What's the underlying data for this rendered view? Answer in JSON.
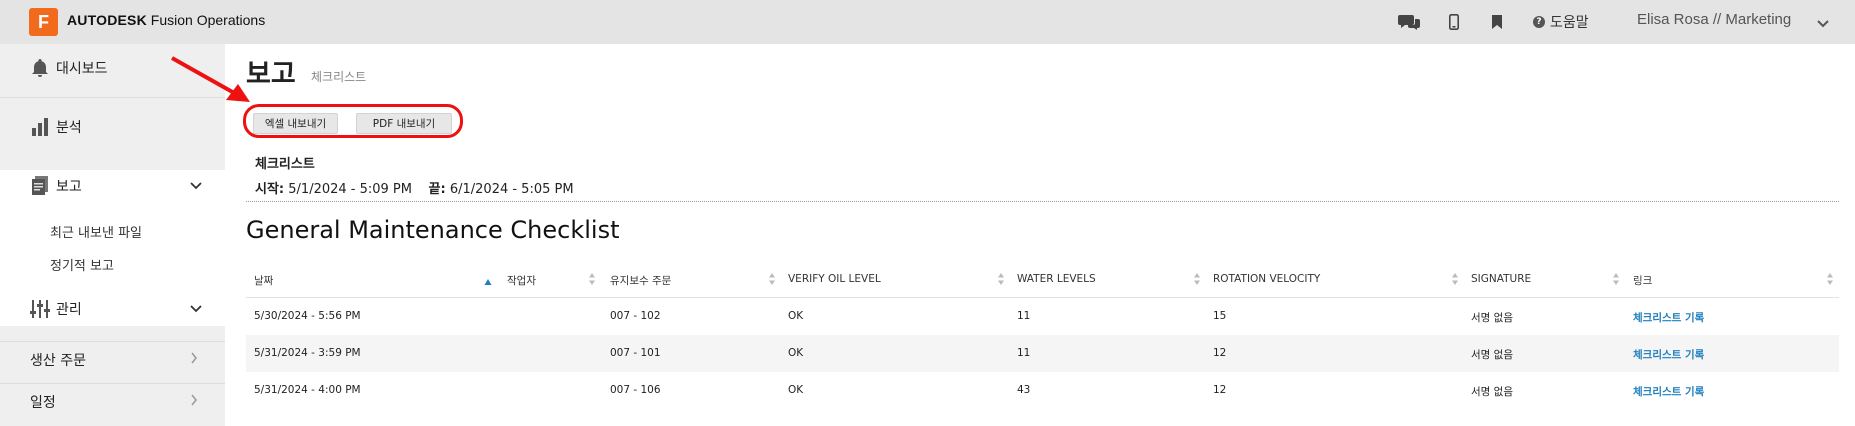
{
  "header": {
    "logo_letter": "F",
    "brand_bold": "AUTODESK",
    "brand_rest": "Fusion Operations",
    "help_label": "도움말",
    "user_label": "Elisa Rosa // Marketing",
    "accent_color": "#f26b1c"
  },
  "sidebar": {
    "items": [
      {
        "label": "대시보드",
        "icon": "bell-icon"
      },
      {
        "label": "분석",
        "icon": "bar-chart-icon"
      },
      {
        "label": "보고",
        "icon": "report-icon"
      },
      {
        "label": "관리",
        "icon": "sliders-icon"
      },
      {
        "label": "생산 주문"
      },
      {
        "label": "일정"
      }
    ],
    "sub_items": [
      "최근 내보낸 파일",
      "정기적 보고"
    ]
  },
  "page": {
    "title": "보고",
    "subtitle": "체크리스트",
    "export_excel": "엑셀 내보내기",
    "export_pdf": "PDF 내보내기",
    "report_name": "체크리스트",
    "start_label": "시작:",
    "start_value": "5/1/2024 - 5:09 PM",
    "end_label": "끝:",
    "end_value": "6/1/2024 - 5:05 PM",
    "checklist_title": "General Maintenance Checklist"
  },
  "table": {
    "columns": [
      "날짜",
      "작업자",
      "유지보수 주문",
      "VERIFY OIL LEVEL",
      "WATER LEVELS",
      "ROTATION VELOCITY",
      "SIGNATURE",
      "링크"
    ],
    "rows": [
      [
        "5/30/2024 - 5:56 PM",
        "",
        "007 - 102",
        "OK",
        "11",
        "15",
        "서명 없음",
        "체크리스트 기록"
      ],
      [
        "5/31/2024 - 3:59 PM",
        "",
        "007 - 101",
        "OK",
        "11",
        "12",
        "서명 없음",
        "체크리스트 기록"
      ],
      [
        "5/31/2024 - 4:00 PM",
        "",
        "007 - 106",
        "OK",
        "43",
        "12",
        "서명 없음",
        "체크리스트 기록"
      ]
    ],
    "link_color": "#1e7fbe"
  }
}
